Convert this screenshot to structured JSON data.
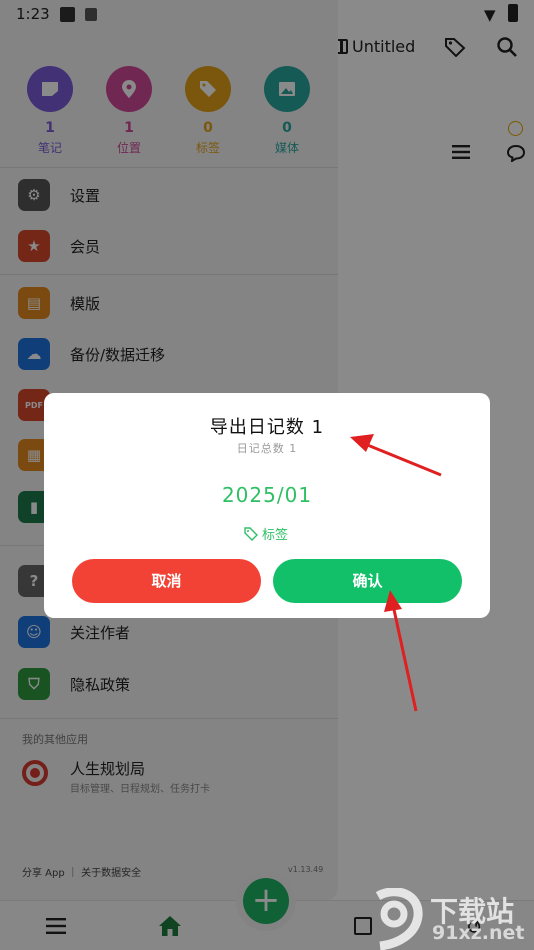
{
  "status_bar": {
    "time": "1:23"
  },
  "app": {
    "notebook_title": "Untitled",
    "icons": [
      "notebook-icon",
      "tag-icon",
      "search-icon",
      "smiley-icon",
      "menu-icon",
      "chat-icon"
    ]
  },
  "drawer": {
    "stats": [
      {
        "count": "1",
        "label": "笔记",
        "color": "#7b5cd6",
        "icon": "note-icon"
      },
      {
        "count": "1",
        "label": "位置",
        "color": "#d04a9a",
        "icon": "location-icon"
      },
      {
        "count": "0",
        "label": "标签",
        "color": "#e3a21a",
        "icon": "tag-icon"
      },
      {
        "count": "0",
        "label": "媒体",
        "color": "#2aa7a0",
        "icon": "image-icon"
      }
    ],
    "menu": [
      {
        "label": "设置",
        "color": "#555555",
        "icon": "gear-icon"
      },
      {
        "label": "会员",
        "color": "#d6462b",
        "icon": "star-icon"
      },
      {
        "label": "模版",
        "color": "#e48a1f",
        "icon": "document-icon"
      },
      {
        "label": "备份/数据迁移",
        "color": "#1f74e0",
        "icon": "cloud-upload-icon"
      },
      {
        "label": "",
        "color": "#d6462b",
        "icon": "pdf-icon"
      },
      {
        "label": "",
        "color": "#e48a1f",
        "icon": "calendar-icon"
      },
      {
        "label": "",
        "color": "#1f7a4d",
        "icon": "book-icon"
      },
      {
        "label": "",
        "color": "#666666",
        "icon": "help-icon"
      },
      {
        "label": "关注作者",
        "color": "#1f74e0",
        "icon": "person-icon"
      },
      {
        "label": "隐私政策",
        "color": "#2e9a3e",
        "icon": "shield-icon"
      }
    ],
    "other_apps_label": "我的其他应用",
    "other_app": {
      "name": "人生规划局",
      "desc": "目标管理、日程规划、任务打卡"
    },
    "footer_links": "分享 App ｜ 关于数据安全",
    "version": "v1.13.49"
  },
  "dialog": {
    "title": "导出日记数 1",
    "subtitle": "日记总数 1",
    "date": "2025/01",
    "tag_label": "标签",
    "cancel_label": "取消",
    "confirm_label": "确认",
    "accent": "#2fbf64"
  },
  "watermark": {
    "line1": "下载站",
    "line2": "91xz.net"
  }
}
